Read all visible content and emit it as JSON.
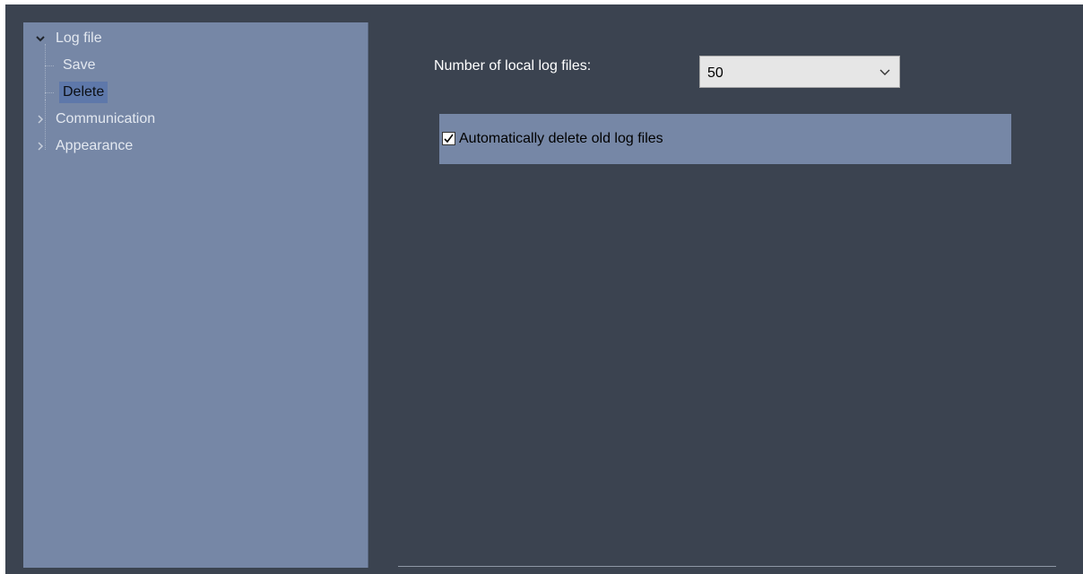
{
  "tree": {
    "items": [
      {
        "label": "Log file",
        "expanded": true,
        "children": [
          {
            "label": "Save",
            "selected": false
          },
          {
            "label": "Delete",
            "selected": true
          }
        ]
      },
      {
        "label": "Communication",
        "expanded": false
      },
      {
        "label": "Appearance",
        "expanded": false
      }
    ]
  },
  "settings": {
    "log_count_label": "Number of local log files:",
    "log_count_value": "50",
    "auto_delete_label": "Automatically delete old log files",
    "auto_delete_checked": true
  },
  "colors": {
    "window_bg": "#3b4350",
    "panel_bg": "#7687a6",
    "selection": "#5e78aa"
  },
  "icons": {
    "expanded": "chevron-down-icon",
    "collapsed": "chevron-right-icon",
    "dropdown": "chevron-down-icon",
    "checkbox": "checkmark-icon"
  }
}
